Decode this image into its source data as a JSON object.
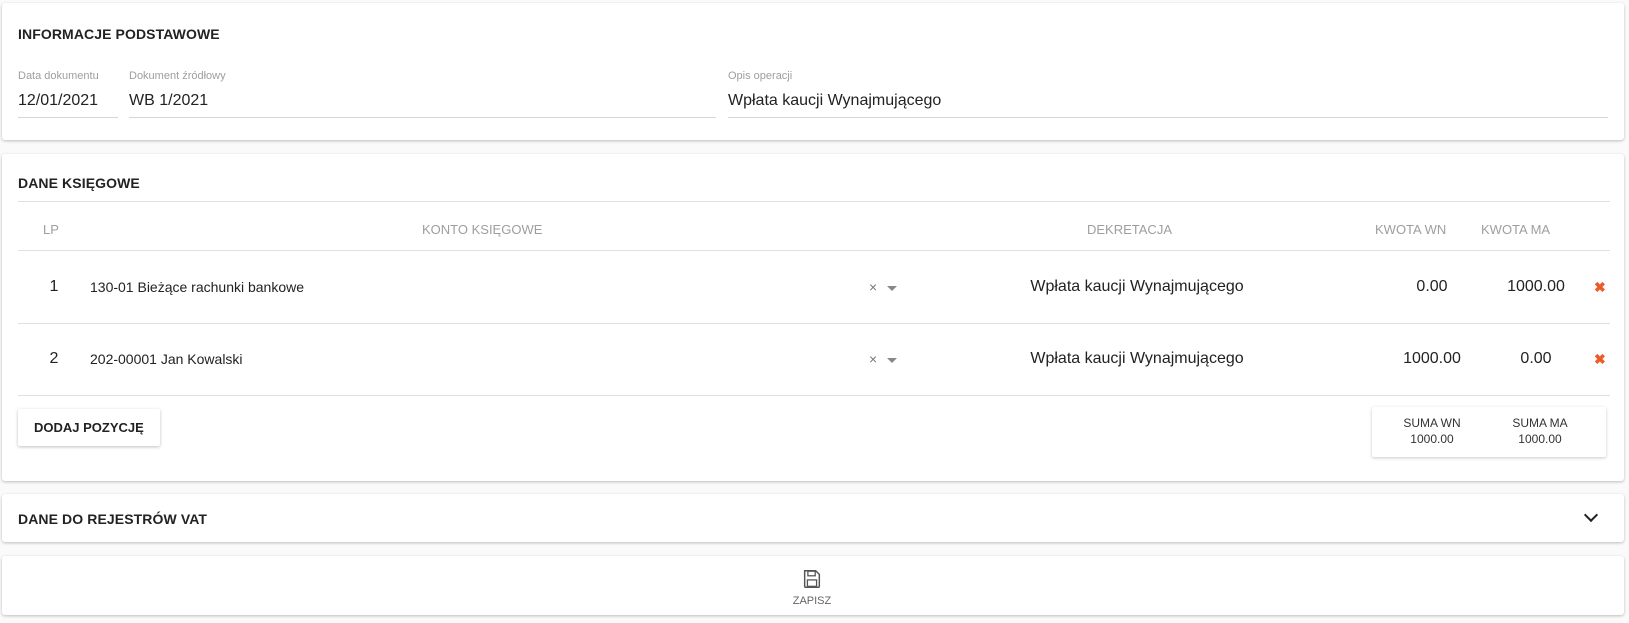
{
  "basic_info": {
    "title": "INFORMACJE PODSTAWOWE",
    "date_label": "Data dokumentu",
    "date_value": "12/01/2021",
    "source_label": "Dokument źródłowy",
    "source_value": "WB 1/2021",
    "desc_label": "Opis operacji",
    "desc_value": "Wpłata kaucji Wynajmującego"
  },
  "accounting": {
    "title": "DANE KSIĘGOWE",
    "columns": {
      "lp": "LP",
      "konto": "KONTO KSIĘGOWE",
      "dekretacja": "DEKRETACJA",
      "kwota_wn": "KWOTA WN",
      "kwota_ma": "KWOTA MA"
    },
    "rows": [
      {
        "lp": "1",
        "konto": "130-01 Bieżące rachunki bankowe",
        "clear": "×",
        "dekretacja": "Wpłata kaucji Wynajmującego",
        "wn": "0.00",
        "ma": "1000.00",
        "delete": "✖"
      },
      {
        "lp": "2",
        "konto": "202-00001 Jan Kowalski",
        "clear": "×",
        "dekretacja": "Wpłata kaucji Wynajmującego",
        "wn": "1000.00",
        "ma": "0.00",
        "delete": "✖"
      }
    ],
    "add_button": "DODAJ POZYCJĘ",
    "sum_wn_label": "SUMA WN",
    "sum_wn_value": "1000.00",
    "sum_ma_label": "SUMA MA",
    "sum_ma_value": "1000.00"
  },
  "vat": {
    "title": "DANE DO REJESTRÓW VAT",
    "toggle_icon": "chevron-down-icon"
  },
  "save": {
    "label": "ZAPISZ",
    "icon": "floppy-disk-icon"
  },
  "colors": {
    "delete": "#f05a28",
    "muted": "#9e9e9e"
  }
}
